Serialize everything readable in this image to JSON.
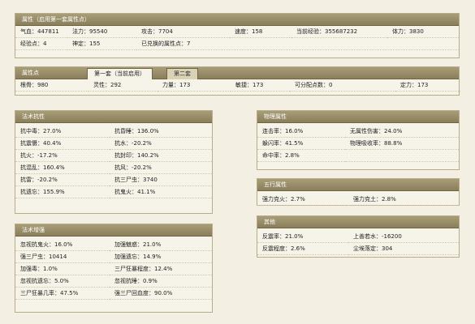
{
  "panel1": {
    "title": "属性（启用第一套属性点）",
    "row1": [
      "气血：447811",
      "法力：95540",
      "攻击：7704",
      "速度：158",
      "当前经验：355687232",
      "体力：3830"
    ],
    "row2": [
      "经验点：4",
      "神定：155",
      "已兑换的属性点：7"
    ]
  },
  "panel2": {
    "title": "属性点",
    "tabs": [
      "第一套（当前启用）",
      "第二套"
    ],
    "row": [
      "根骨：980",
      "灵性：292",
      "力量：173",
      "敏捷：173",
      "可分配点数：0",
      "定力：173"
    ]
  },
  "magic_resist": {
    "title": "法术抗性",
    "rows": [
      [
        "抗中毒：27.0%",
        "抗昏睡：136.0%"
      ],
      [
        "抗震慑：40.4%",
        "抗水：-20.2%"
      ],
      [
        "抗火：-17.2%",
        "抗封印：140.2%"
      ],
      [
        "抗混乱：160.4%",
        "抗风：-20.2%"
      ],
      [
        "抗雷：-20.2%",
        "抗三尸虫：3740"
      ],
      [
        "抗遗忘：155.9%",
        "抗鬼火：41.1%"
      ]
    ]
  },
  "magic_boost": {
    "title": "法术增强",
    "rows": [
      [
        "忽视抗鬼火：16.0%",
        "加强魅惑：21.0%"
      ],
      [
        "强三尸虫：10414",
        "加强遗忘：14.9%"
      ],
      [
        "加强毒：1.0%",
        "三尸狂暴程度：12.4%"
      ],
      [
        "忽视抗遗忘：5.0%",
        "忽视抗睡：0.9%"
      ],
      [
        "三尸狂暴几率：47.5%",
        "强三尸回血度：90.0%"
      ]
    ]
  },
  "physical": {
    "title": "物理属性",
    "rows": [
      [
        "连击率：16.0%",
        "无属性伤害：24.0%"
      ],
      [
        "躲闪率：41.5%",
        "物理吸收率：88.8%"
      ],
      [
        "命中率：2.8%",
        ""
      ]
    ]
  },
  "wuxing": {
    "title": "五行属性",
    "rows": [
      [
        "强力克火：2.7%",
        "强力克土：2.8%"
      ]
    ]
  },
  "other": {
    "title": "其他",
    "rows": [
      [
        "反震率：21.0%",
        "上善若水：-16200"
      ],
      [
        "反震程度：2.6%",
        "尘埃落定：304"
      ]
    ]
  }
}
